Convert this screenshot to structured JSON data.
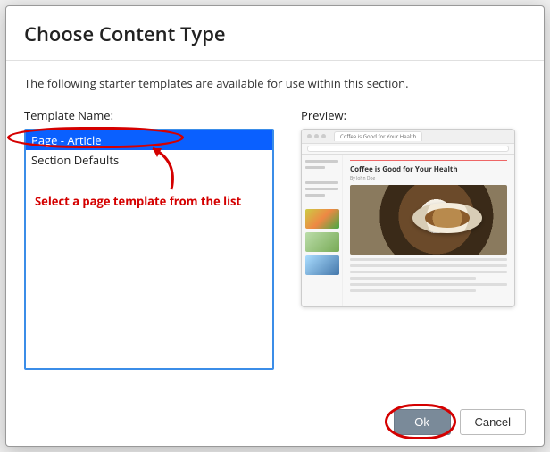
{
  "dialog": {
    "title": "Choose Content Type",
    "intro": "The following starter templates are available for use within this section.",
    "template_name_label": "Template Name:",
    "preview_label": "Preview:"
  },
  "templates": {
    "items": [
      {
        "label": "Page - Article",
        "selected": true
      },
      {
        "label": "Section Defaults",
        "selected": false
      }
    ]
  },
  "preview": {
    "tab_title": "Coffee is Good for Your Health",
    "article_title": "Coffee is Good for Your Health",
    "byline": "By John Doe"
  },
  "footer": {
    "ok_label": "Ok",
    "cancel_label": "Cancel"
  },
  "annotations": {
    "instruction": "Select a page template from the list"
  }
}
